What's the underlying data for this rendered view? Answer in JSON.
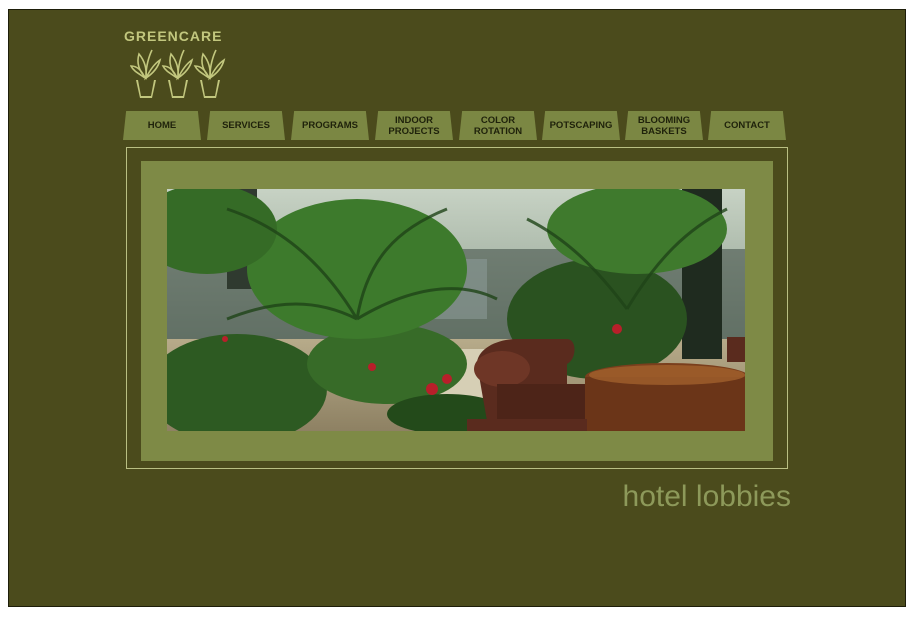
{
  "brand": {
    "name": "GREENCARE"
  },
  "nav": {
    "items": [
      {
        "label": "HOME"
      },
      {
        "label": "SERVICES"
      },
      {
        "label": "PROGRAMS"
      },
      {
        "label": "INDOOR\nPROJECTS"
      },
      {
        "label": "COLOR\nROTATION"
      },
      {
        "label": "POTSCAPING"
      },
      {
        "label": "BLOOMING\nBASKETS"
      },
      {
        "label": "CONTACT"
      }
    ]
  },
  "main": {
    "caption": "hotel lobbies"
  },
  "colors": {
    "background": "#4b4b1c",
    "tab": "#7b8743",
    "mat": "#7e8a46",
    "caption": "#8d995a",
    "logo": "#c2c77e"
  },
  "icons": {
    "logo": "potted-plant-icon"
  }
}
